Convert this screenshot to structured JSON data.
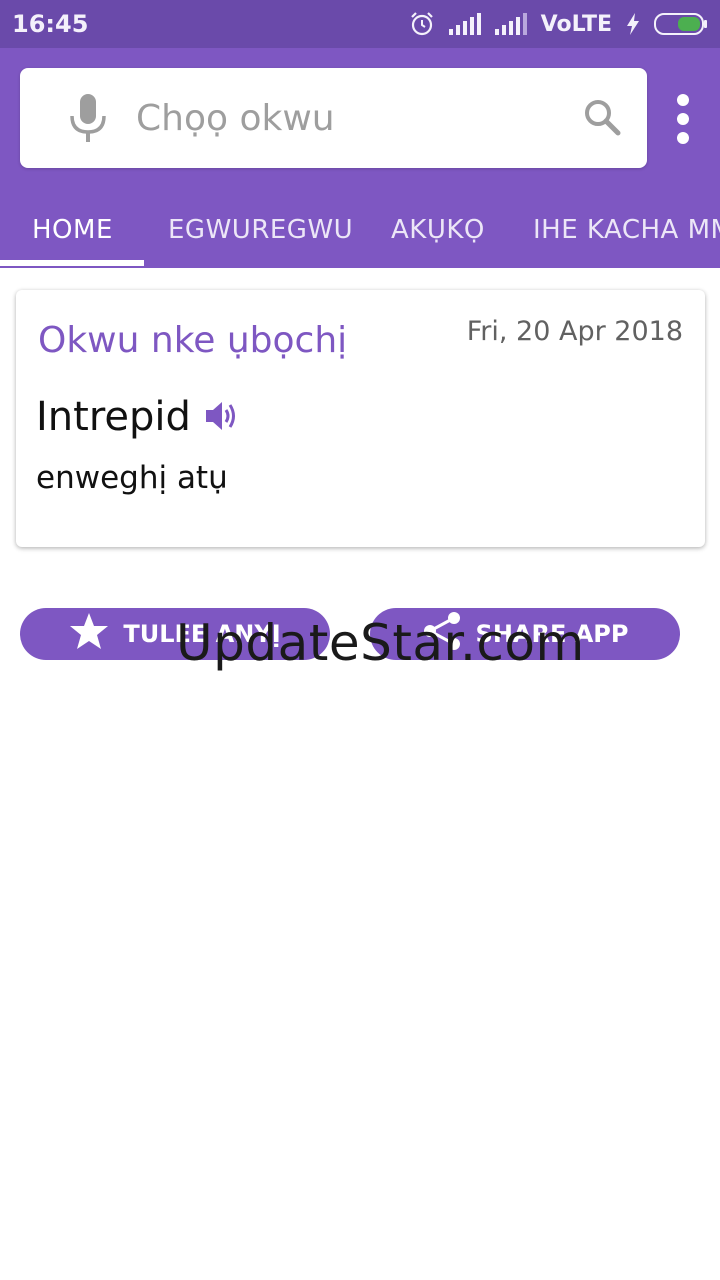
{
  "status_bar": {
    "time": "16:45",
    "network": "VoLTE",
    "icons": [
      "alarm-icon",
      "signal-icon",
      "signal-icon",
      "charging-icon",
      "battery-icon"
    ]
  },
  "search": {
    "placeholder": "Chọọ okwu"
  },
  "tabs": [
    {
      "label": "HOME",
      "active": true
    },
    {
      "label": "EGWUREGWU",
      "active": false
    },
    {
      "label": "AKỤKỌ",
      "active": false
    },
    {
      "label": "IHE KACHA MMA",
      "active": false
    }
  ],
  "word_of_day": {
    "title": "Okwu nke ụbọchị",
    "date": "Fri, 20 Apr 2018",
    "word": "Intrepid",
    "meaning": "enweghị atụ"
  },
  "actions": {
    "rate_label": "TULEE ANYỊ",
    "share_label": "SHARE APP"
  },
  "watermark": "UpdateStar.com",
  "colors": {
    "primary": "#7e57c2",
    "status_bar": "#6a4aaa",
    "battery": "#4caf50"
  }
}
